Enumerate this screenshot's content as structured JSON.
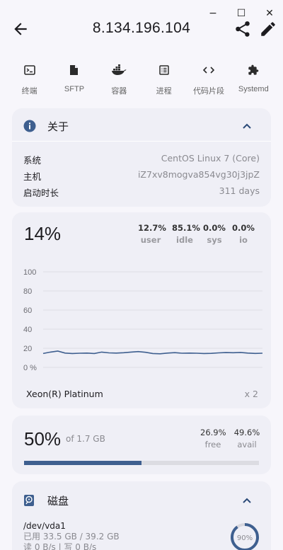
{
  "window": {
    "min": "−",
    "max": "☐",
    "close": "✕"
  },
  "header": {
    "title": "8.134.196.104"
  },
  "toolbar": [
    {
      "label": "终端",
      "icon": "terminal-icon"
    },
    {
      "label": "SFTP",
      "icon": "file-icon"
    },
    {
      "label": "容器",
      "icon": "docker-icon"
    },
    {
      "label": "进程",
      "icon": "list-icon"
    },
    {
      "label": "代码片段",
      "icon": "code-icon"
    },
    {
      "label": "Systemd",
      "icon": "puzzle-icon"
    }
  ],
  "about": {
    "title": "关于",
    "rows": [
      {
        "key": "系统",
        "value": "CentOS Linux 7 (Core)"
      },
      {
        "key": "主机",
        "value": "iZ7xv8mogva854vg30j3jpZ"
      },
      {
        "key": "启动时长",
        "value": "311 days"
      }
    ]
  },
  "cpu": {
    "usage": "14%",
    "stats": [
      {
        "value": "12.7%",
        "label": "user"
      },
      {
        "value": "85.1%",
        "label": "idle"
      },
      {
        "value": "0.0%",
        "label": "sys"
      },
      {
        "value": "0.0%",
        "label": "io"
      }
    ],
    "model": "Xeon(R) Platinum",
    "cores": "x 2"
  },
  "chart_data": {
    "type": "line",
    "y_ticks": [
      "100",
      "80",
      "60",
      "40",
      "20",
      "0 %"
    ],
    "ylim": [
      0,
      100
    ],
    "grid": true,
    "series": [
      {
        "values": [
          14.5,
          16,
          17,
          15,
          14.5,
          14.8,
          15,
          14.5,
          16,
          15.2,
          15,
          15.3,
          16,
          16.5,
          15.8,
          14.5,
          14.2,
          15,
          15.4,
          14.8,
          15,
          14.8,
          14.5,
          14.7,
          15.2,
          15.5,
          15.3,
          15.6,
          15,
          14.6,
          14.8
        ]
      }
    ],
    "color": "#3e5f8f"
  },
  "memory": {
    "usage": "50%",
    "total": "of 1.7 GB",
    "free_value": "26.9%",
    "free_label": "free",
    "avail_value": "49.6%",
    "avail_label": "avail",
    "used_fraction": 0.5
  },
  "disk": {
    "title": "磁盘",
    "device": "/dev/vda1",
    "usage_text": "已用 33.5 GB / 39.2 GB",
    "io_text": "读 0 B/s | 写 0 B/s",
    "percent": "90%",
    "percent_fraction": 0.9
  },
  "colors": {
    "accent": "#3e5f8f",
    "card": "#efeff6",
    "background": "#f7f6fb"
  }
}
